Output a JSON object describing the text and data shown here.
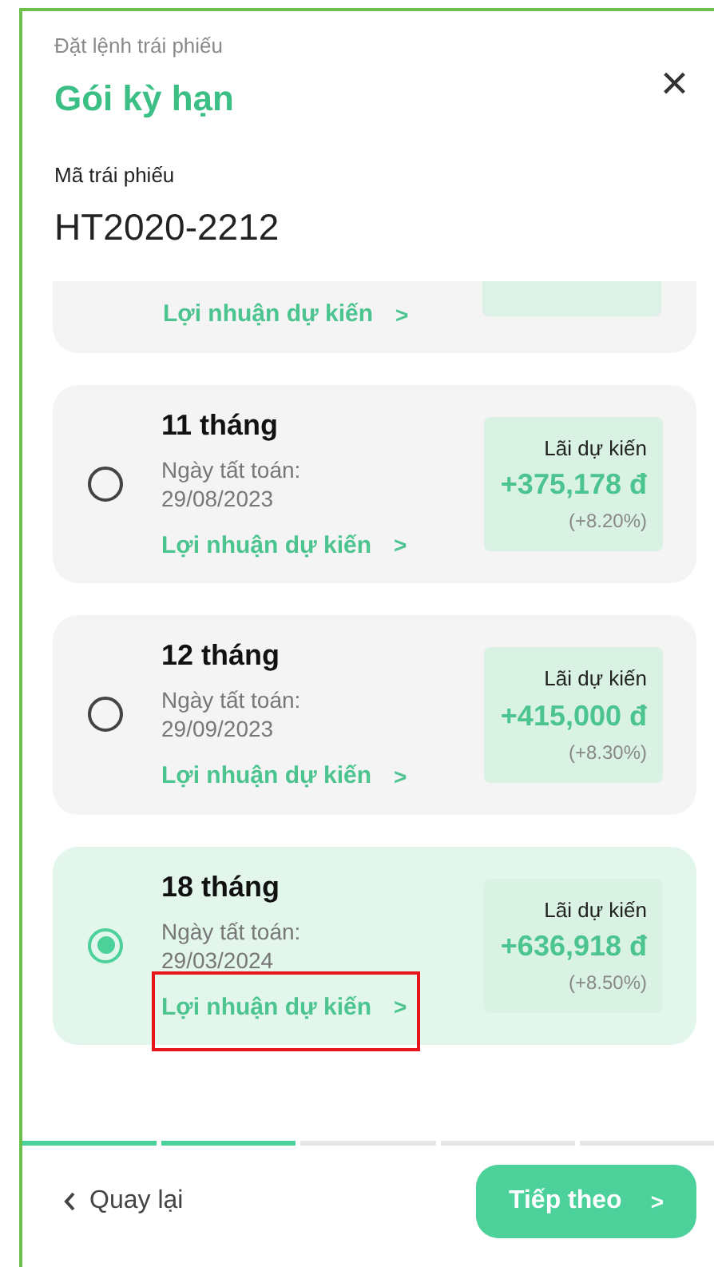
{
  "header": {
    "breadcrumb": "Đặt lệnh trái phiếu",
    "title": "Gói kỳ hạn",
    "close": "×"
  },
  "bond": {
    "label": "Mã trái phiếu",
    "code": "HT2020-2212"
  },
  "partial_option": {
    "link": "Lợi nhuận dự kiến",
    "chevron": ">"
  },
  "options": [
    {
      "term": "11 tháng",
      "date_label": "Ngày tất toán:",
      "date": "29/08/2023",
      "link": "Lợi nhuận dự kiến",
      "chevron": ">",
      "reward_label": "Lãi dự kiến",
      "amount": "+375,178 đ",
      "rate": "(+8.20%)",
      "selected": false,
      "annotated": false
    },
    {
      "term": "12 tháng",
      "date_label": "Ngày tất toán:",
      "date": "29/09/2023",
      "link": "Lợi nhuận dự kiến",
      "chevron": ">",
      "reward_label": "Lãi dự kiến",
      "amount": "+415,000 đ",
      "rate": "(+8.30%)",
      "selected": false,
      "annotated": false
    },
    {
      "term": "18 tháng",
      "date_label": "Ngày tất toán:",
      "date": "29/03/2024",
      "link": "Lợi nhuận dự kiến",
      "chevron": ">",
      "reward_label": "Lãi dự kiến",
      "amount": "+636,918 đ",
      "rate": "(+8.50%)",
      "selected": true,
      "annotated": true
    }
  ],
  "steps": [
    {
      "done": true
    },
    {
      "done": true
    },
    {
      "done": false
    },
    {
      "done": false
    },
    {
      "done": false
    }
  ],
  "footer": {
    "back": "Quay lại",
    "next": "Tiếp theo",
    "next_chevron": ">"
  }
}
